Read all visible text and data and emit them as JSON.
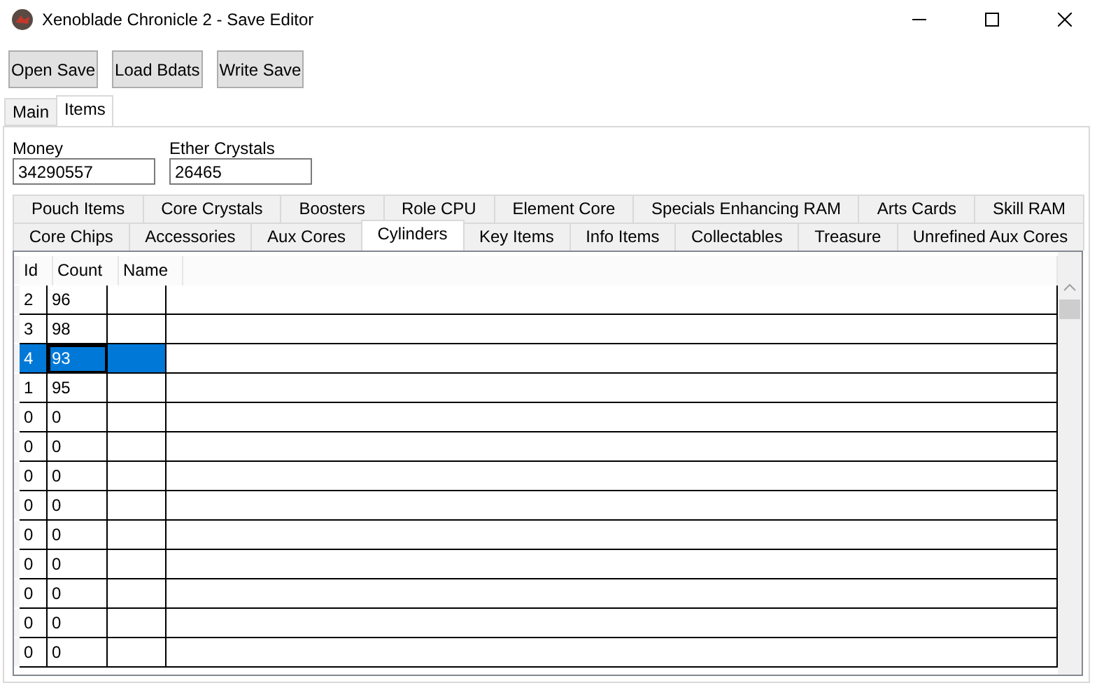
{
  "window": {
    "title": "Xenoblade Chronicle 2 - Save Editor"
  },
  "toolbar": [
    "Open Save",
    "Load Bdats",
    "Write Save"
  ],
  "main_tabs": [
    {
      "label": "Main",
      "selected": false
    },
    {
      "label": "Items",
      "selected": true
    }
  ],
  "fields": [
    {
      "label": "Money",
      "value": "34290557"
    },
    {
      "label": "Ether Crystals",
      "value": "26465"
    }
  ],
  "item_tabs": [
    [
      {
        "label": "Pouch Items",
        "selected": false
      },
      {
        "label": "Core Crystals",
        "selected": false
      },
      {
        "label": "Boosters",
        "selected": false
      },
      {
        "label": "Role CPU",
        "selected": false
      },
      {
        "label": "Element Core",
        "selected": false
      },
      {
        "label": "Specials Enhancing RAM",
        "selected": false
      },
      {
        "label": "Arts Cards",
        "selected": false
      },
      {
        "label": "Skill RAM",
        "selected": false
      }
    ],
    [
      {
        "label": "Core Chips",
        "selected": false
      },
      {
        "label": "Accessories",
        "selected": false
      },
      {
        "label": "Aux Cores",
        "selected": false
      },
      {
        "label": "Cylinders",
        "selected": true
      },
      {
        "label": "Key Items",
        "selected": false
      },
      {
        "label": "Info Items",
        "selected": false
      },
      {
        "label": "Collectables",
        "selected": false
      },
      {
        "label": "Treasure",
        "selected": false
      },
      {
        "label": "Unrefined Aux Cores",
        "selected": false
      }
    ]
  ],
  "table": {
    "columns": [
      "Id",
      "Count",
      "Name"
    ],
    "rows": [
      {
        "id": "2",
        "count": "96",
        "selected": false
      },
      {
        "id": "3",
        "count": "98",
        "selected": false
      },
      {
        "id": "4",
        "count": "93",
        "selected": true
      },
      {
        "id": "1",
        "count": "95",
        "selected": false
      },
      {
        "id": "0",
        "count": "0",
        "selected": false
      },
      {
        "id": "0",
        "count": "0",
        "selected": false
      },
      {
        "id": "0",
        "count": "0",
        "selected": false
      },
      {
        "id": "0",
        "count": "0",
        "selected": false
      },
      {
        "id": "0",
        "count": "0",
        "selected": false
      },
      {
        "id": "0",
        "count": "0",
        "selected": false
      },
      {
        "id": "0",
        "count": "0",
        "selected": false
      },
      {
        "id": "0",
        "count": "0",
        "selected": false
      },
      {
        "id": "0",
        "count": "0",
        "selected": false
      }
    ]
  }
}
